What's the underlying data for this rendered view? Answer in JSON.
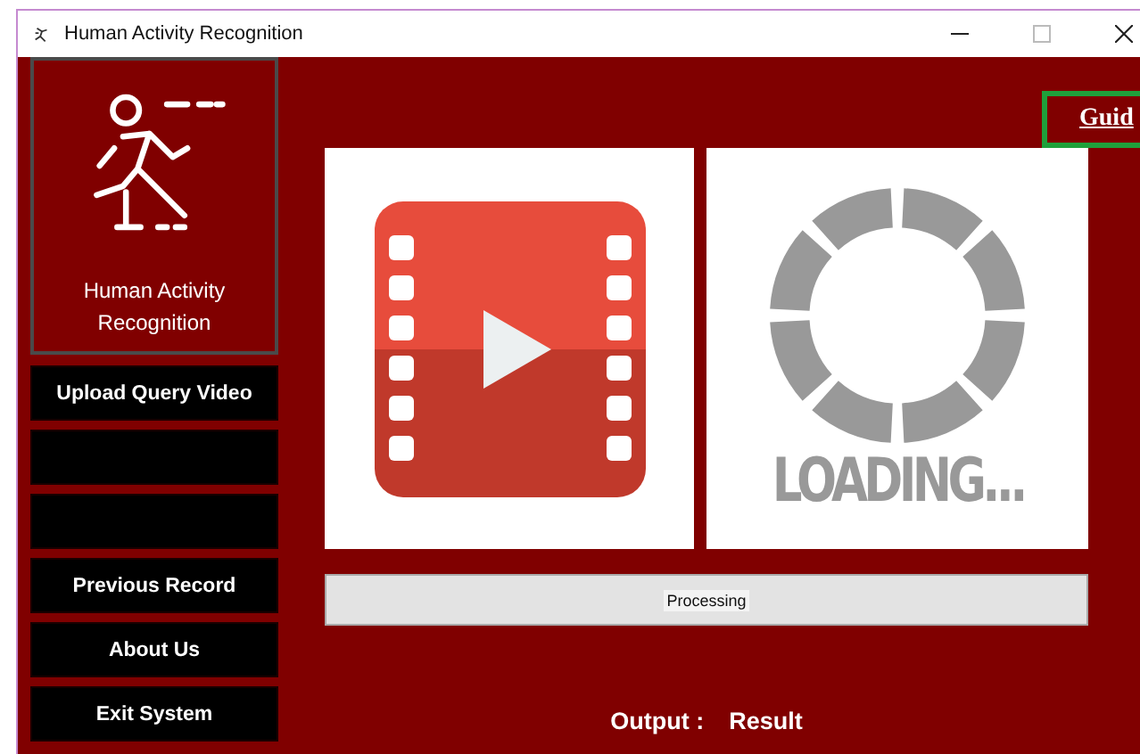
{
  "window": {
    "title": "Human Activity Recognition"
  },
  "logo": {
    "caption_lines": [
      "Human Activity",
      "Recognition"
    ]
  },
  "sidebar_buttons": [
    {
      "kind": "labeled",
      "label": "Upload Query Video"
    },
    {
      "kind": "blank"
    },
    {
      "kind": "blank"
    },
    {
      "kind": "labeled",
      "label": "Previous Record"
    },
    {
      "kind": "labeled",
      "label": "About Us"
    },
    {
      "kind": "labeled",
      "label": "Exit System"
    }
  ],
  "guide_button": {
    "label": "Guid"
  },
  "loading_panel": {
    "text": "LOADING..."
  },
  "progress": {
    "label": "Processing",
    "level": 0
  },
  "output": {
    "label": "Output :",
    "value": "Result"
  }
}
